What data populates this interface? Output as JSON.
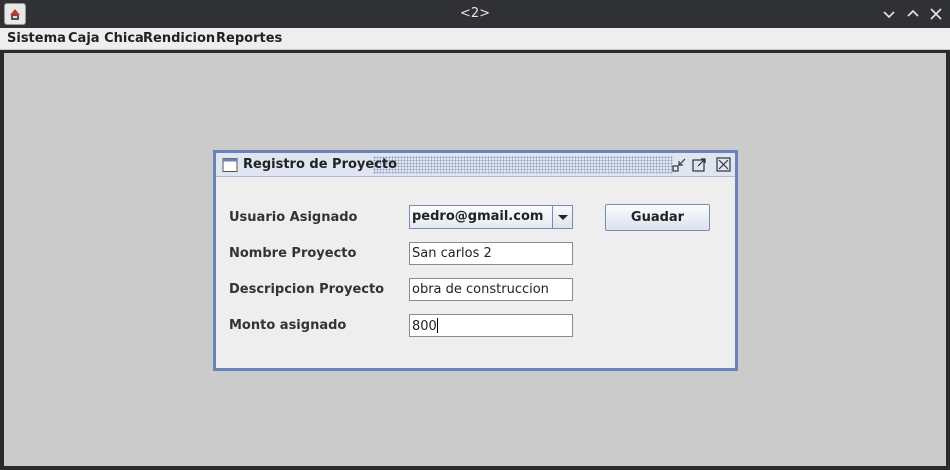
{
  "window": {
    "title": "<2>"
  },
  "menubar": {
    "items": [
      "Sistema",
      "Caja Chica",
      "Rendicion",
      "Reportes"
    ]
  },
  "frame": {
    "title": "Registro de Proyecto",
    "labels": {
      "usuario": "Usuario Asignado",
      "nombre": "Nombre Proyecto",
      "descripcion": "Descripcion Proyecto",
      "monto": "Monto asignado"
    },
    "values": {
      "usuario": "pedro@gmail.com",
      "nombre": "San carlos 2",
      "descripcion": "obra de construccion",
      "monto": "800"
    },
    "save_label": "Guadar"
  },
  "colors": {
    "frame_border": "#6a83b8",
    "desktop": "#cbcbcb",
    "titlebar": "#2f3134"
  },
  "icons": [
    "java-app-icon",
    "minimize-icon",
    "maximize-icon",
    "close-icon",
    "frame-window-icon",
    "frame-iconify-icon",
    "frame-maximize-icon",
    "frame-close-icon",
    "dropdown-arrow-icon"
  ]
}
